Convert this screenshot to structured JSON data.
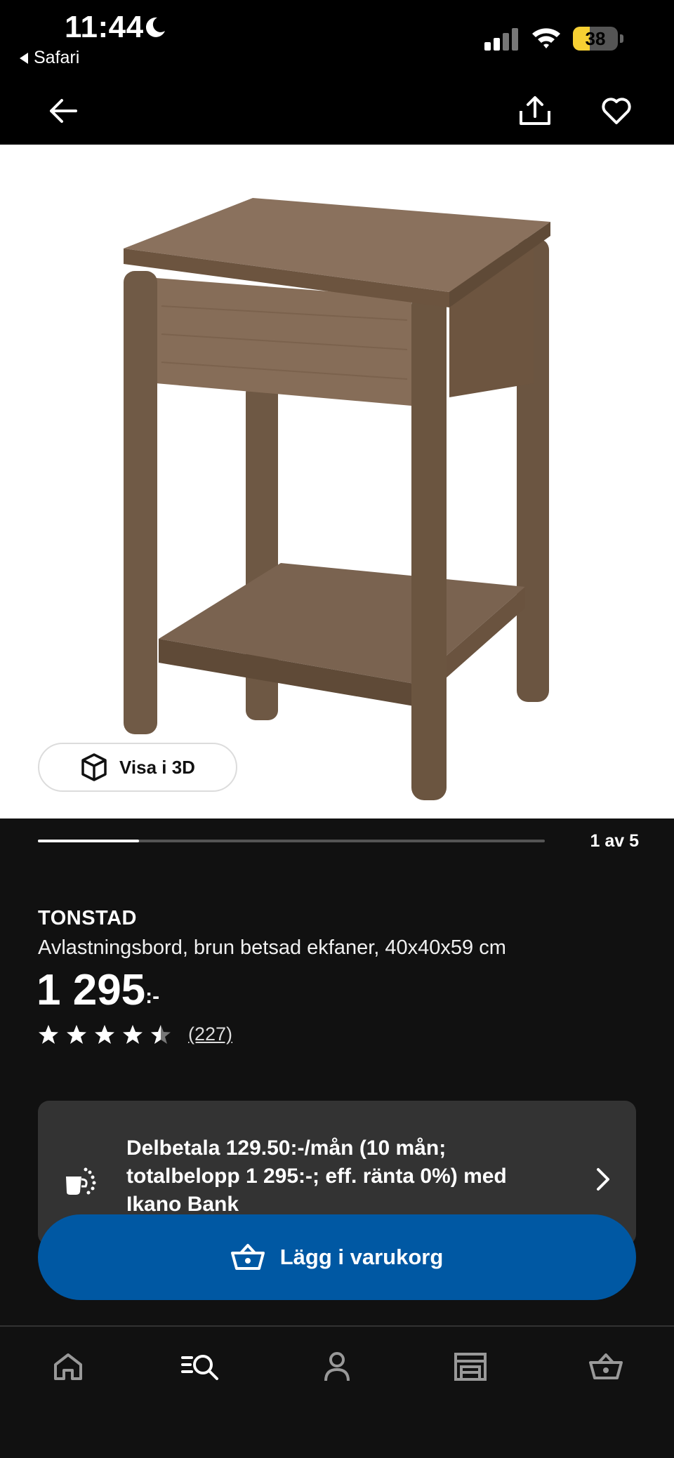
{
  "status_bar": {
    "time": "11:44",
    "back_app": "Safari",
    "battery": "38",
    "battery_level": 0.38
  },
  "header": {
    "back_icon": "arrow-left-icon",
    "share_icon": "share-icon",
    "favorite_icon": "heart-icon"
  },
  "gallery": {
    "view_3d_label": "Visa i 3D",
    "page_indicator": "1 av 5",
    "current_image": 1,
    "total_images": 5
  },
  "product": {
    "name": "TONSTAD",
    "description": "Avlastningsbord, brun betsad ekfaner, 40x40x59 cm",
    "price": "1 295",
    "price_suffix": ":-",
    "rating": 4.5,
    "review_count": "(227)"
  },
  "installment": {
    "text": "Delbetala 129.50:-/mån (10 mån; totalbelopp 1 295:-; eff. ränta 0%) med Ikano Bank"
  },
  "cart_button": {
    "label": "Lägg i varukorg"
  },
  "tab_bar": {
    "items": [
      {
        "icon": "home-icon"
      },
      {
        "icon": "search-list-icon"
      },
      {
        "icon": "profile-icon"
      },
      {
        "icon": "store-icon"
      },
      {
        "icon": "basket-icon"
      }
    ]
  },
  "colors": {
    "background": "#111111",
    "accent_blue": "#0058a3",
    "card": "#333333",
    "battery": "#f7d033"
  }
}
